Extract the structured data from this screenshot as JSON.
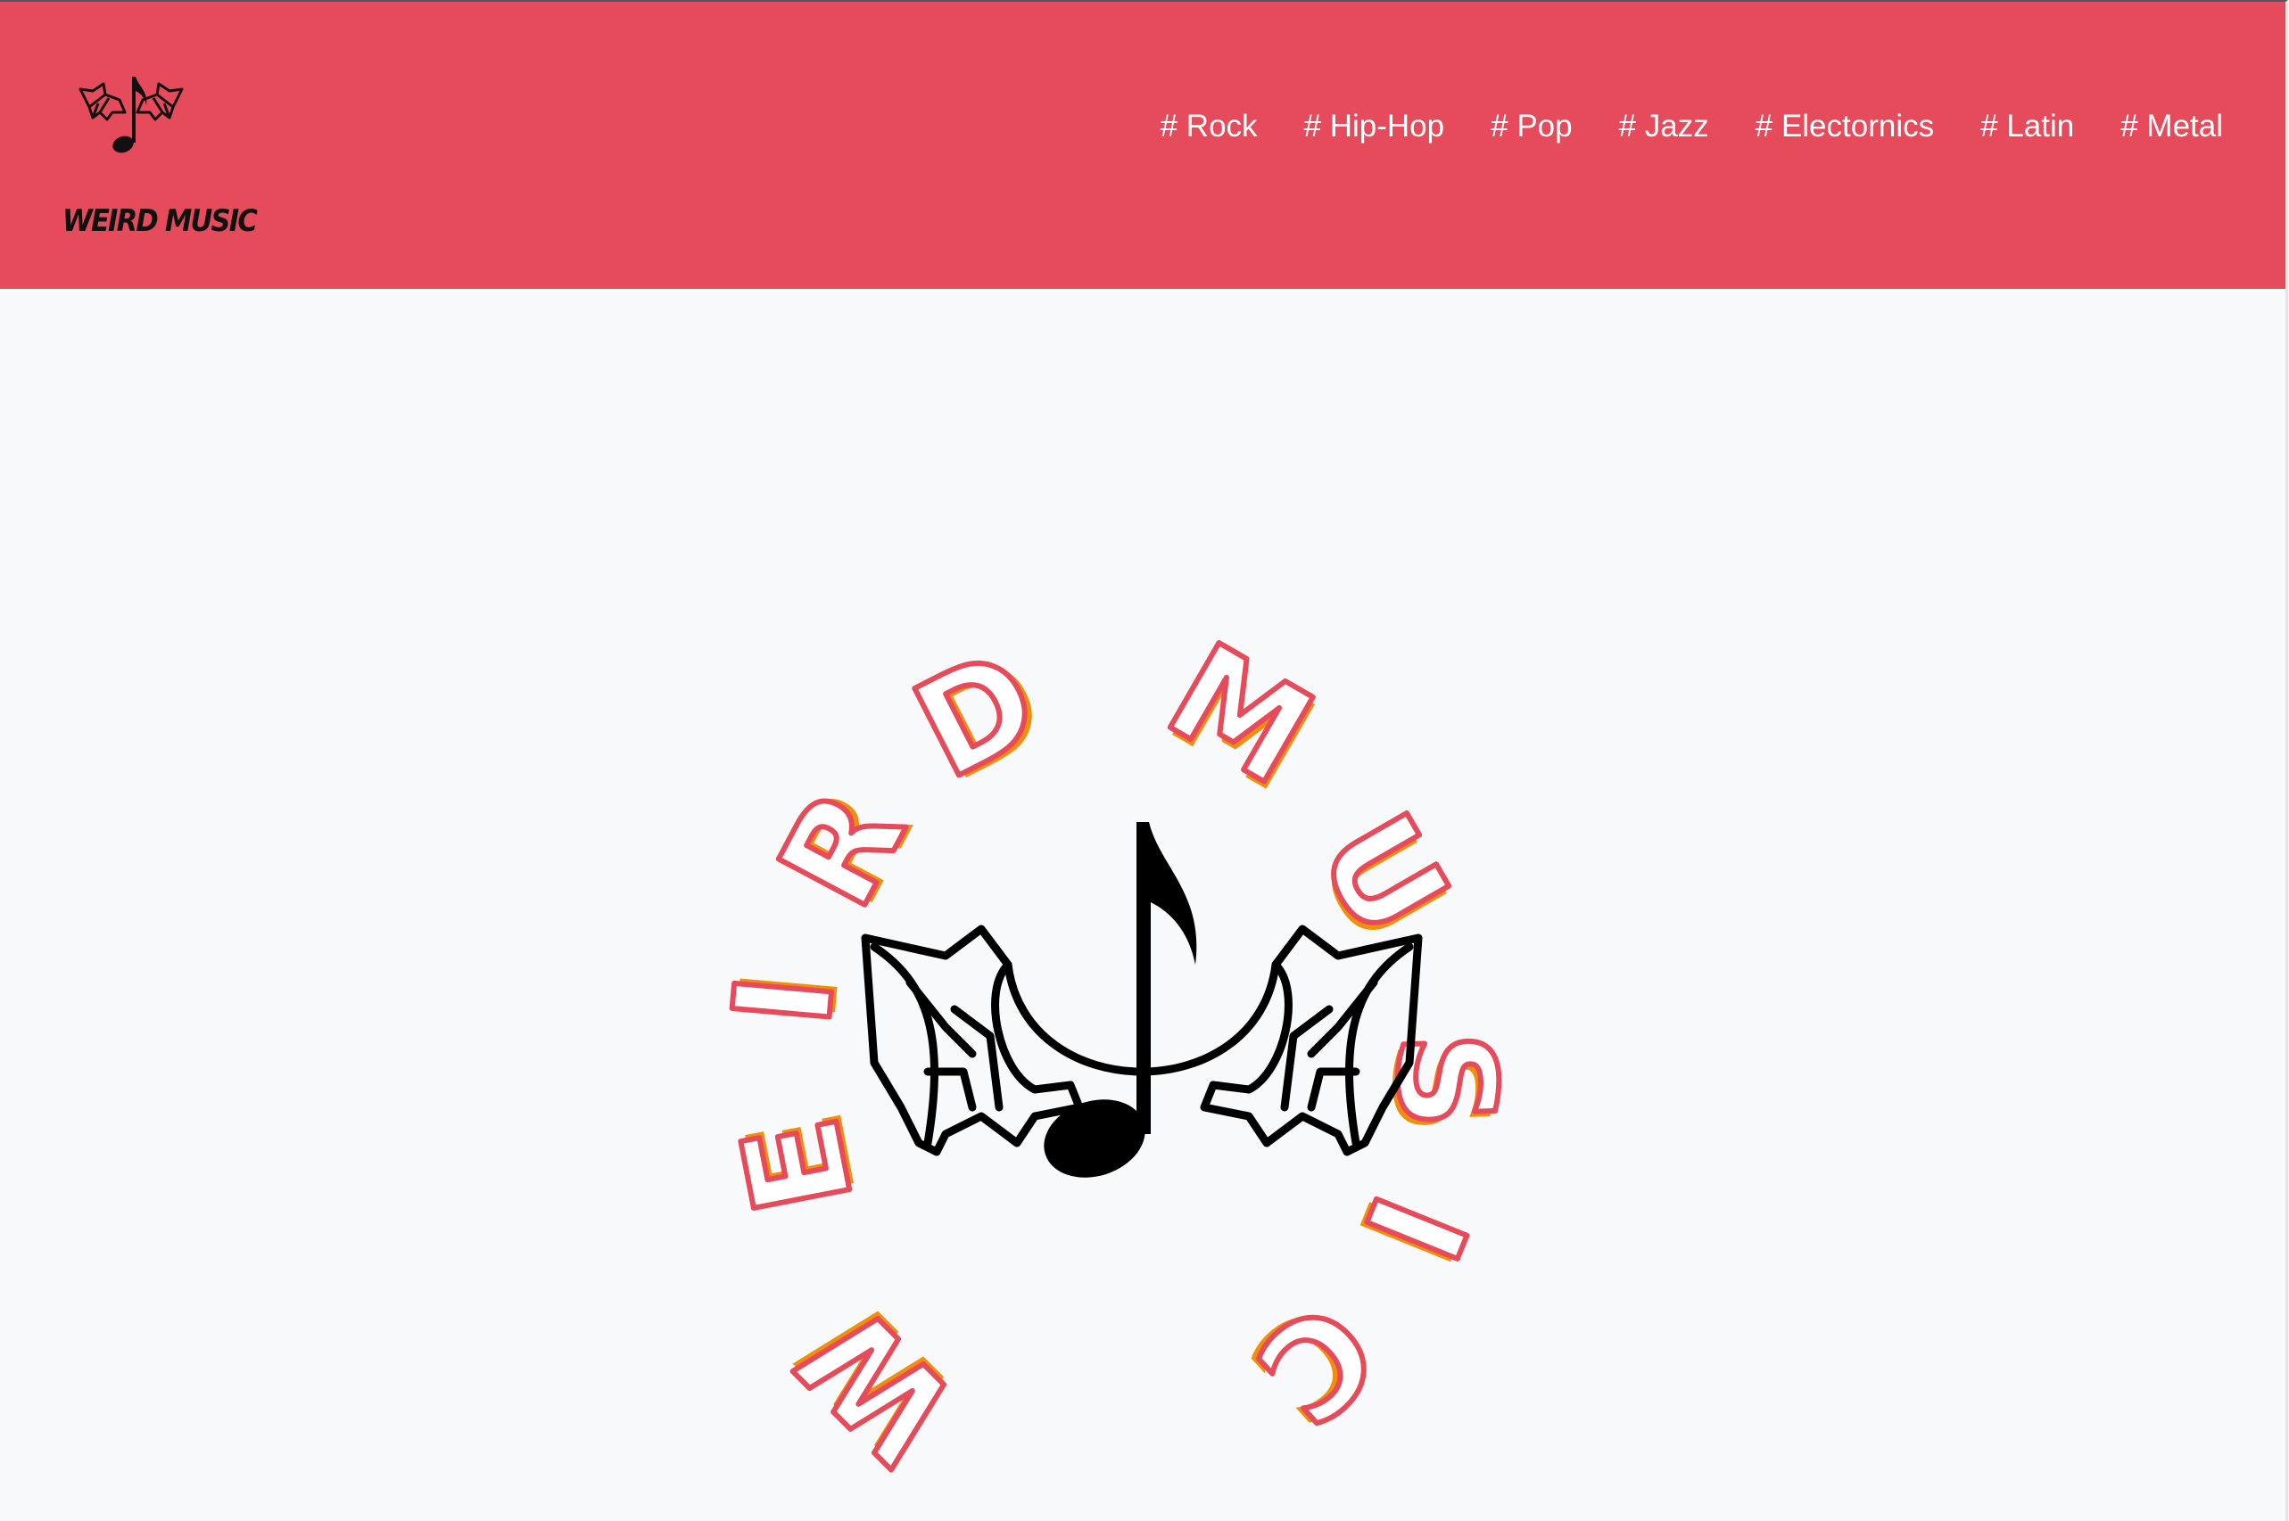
{
  "brand": {
    "name": "WEIRD MUSIC",
    "logo_icon": "bat-wing-music-note-icon"
  },
  "nav": {
    "items": [
      {
        "label": "# Rock"
      },
      {
        "label": "# Hip-Hop"
      },
      {
        "label": "# Pop"
      },
      {
        "label": "# Jazz"
      },
      {
        "label": "# Electornics"
      },
      {
        "label": "# Latin"
      },
      {
        "label": "# Metal"
      }
    ]
  },
  "hero": {
    "logo_letters": [
      "W",
      "E",
      "I",
      "R",
      "D",
      "M",
      "U",
      "S",
      "I",
      "C"
    ],
    "logo_icon": "bat-wing-music-note-icon"
  },
  "colors": {
    "header_bg": "#e64b5c",
    "page_bg": "#f8f9fa",
    "nav_text": "#ffffff",
    "letter_fill": "#f0900a",
    "letter_outline": "#e64b5c"
  }
}
